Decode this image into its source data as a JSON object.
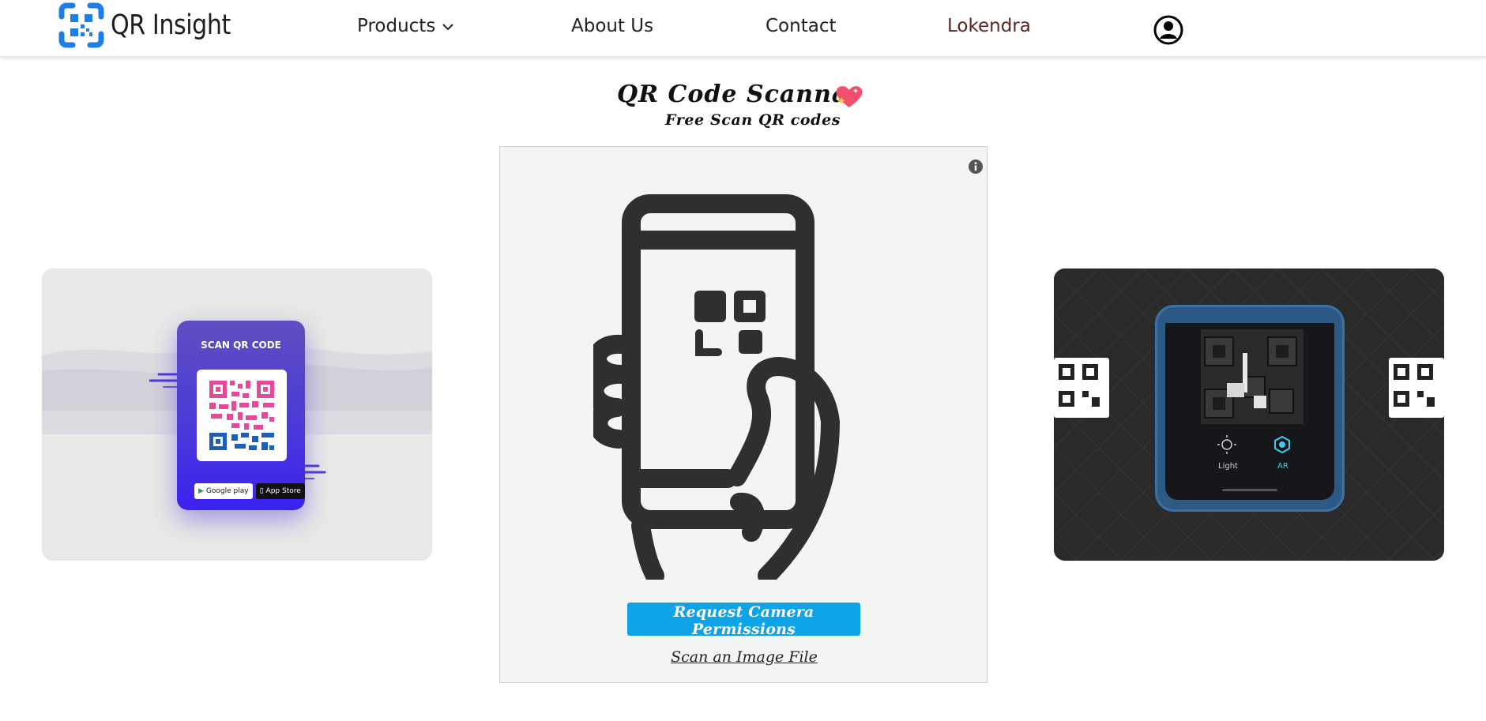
{
  "header": {
    "brand": "QR Insight",
    "nav": {
      "products": "Products",
      "about": "About Us",
      "contact": "Contact",
      "user": "Lokendra"
    }
  },
  "main": {
    "title": "QR Code Scannar",
    "subtitle": "Free Scan QR codes"
  },
  "left_promo": {
    "label": "SCAN QR CODE",
    "google_badge": "Google play",
    "apple_badge": "App Store"
  },
  "right_promo": {
    "mode_light": "Light",
    "mode_ar": "AR"
  },
  "scanner": {
    "request_button": "Request Camera Permissions",
    "scan_file_link": "Scan an Image File"
  },
  "colors": {
    "accent_button": "#0ea2e6",
    "logo_blue": "#1d7ee6",
    "user_name": "#5a2424",
    "promo_purple": "#4a3ad8"
  },
  "icons": {
    "logo": "qr-logo-icon",
    "products_dropdown": "chevron-down-icon",
    "account": "account-circle-icon",
    "title_decoration": "sparkling-heart-icon",
    "info": "info-icon"
  }
}
